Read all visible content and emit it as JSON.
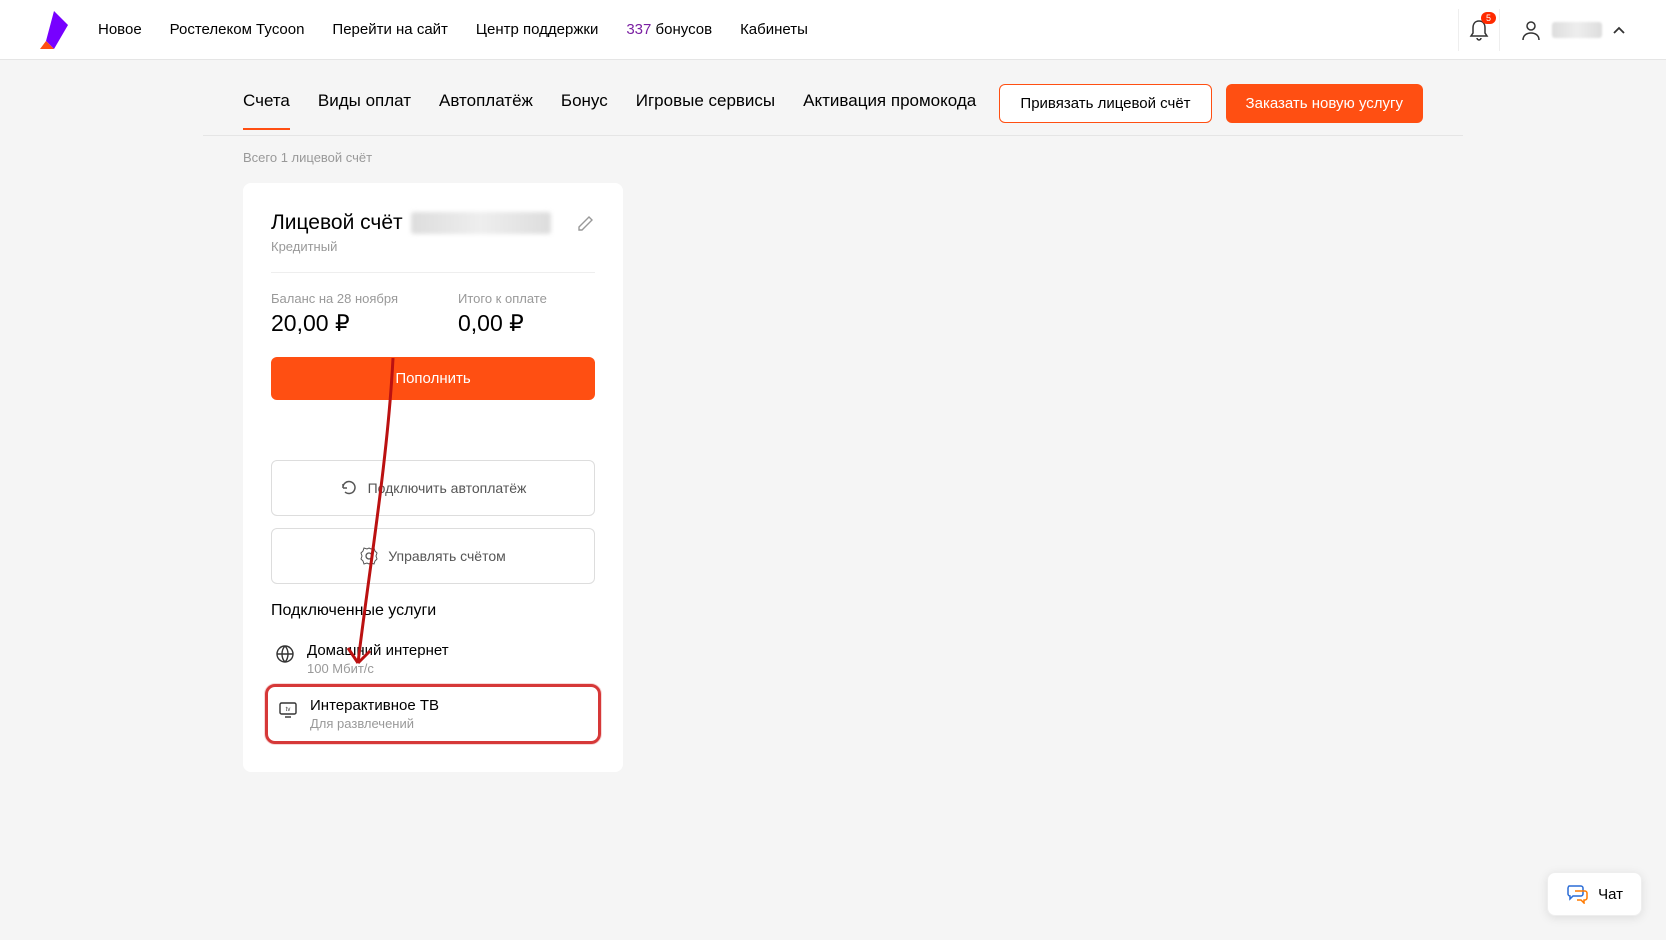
{
  "header": {
    "nav": [
      "Новое",
      "Ростелеком Tycoon",
      "Перейти на сайт",
      "Центр поддержки"
    ],
    "bonus_count": "337",
    "bonus_label": "бонусов",
    "cabinets": "Кабинеты",
    "notif_count": "5"
  },
  "tabs": {
    "items": [
      "Счета",
      "Виды оплат",
      "Автоплатёж",
      "Бонус",
      "Игровые сервисы",
      "Активация промокода"
    ],
    "active_index": 0
  },
  "actions": {
    "link_account": "Привязать лицевой счёт",
    "order_service": "Заказать новую услугу"
  },
  "account_count_text": "Всего 1 лицевой счёт",
  "card": {
    "title": "Лицевой счёт",
    "subtitle": "Кредитный",
    "balance_label": "Баланс на 28 ноября",
    "balance_value": "20,00 ₽",
    "due_label": "Итого к оплате",
    "due_value": "0,00 ₽",
    "refill_btn": "Пополнить",
    "autopay_btn": "Подключить автоплатёж",
    "manage_btn": "Управлять счётом",
    "services_title": "Подключенные услуги",
    "services": [
      {
        "name": "Домашний интернет",
        "desc": "100 Мбит/с"
      },
      {
        "name": "Интерактивное ТВ",
        "desc": "Для развлечений"
      }
    ]
  },
  "chat_label": "Чат"
}
